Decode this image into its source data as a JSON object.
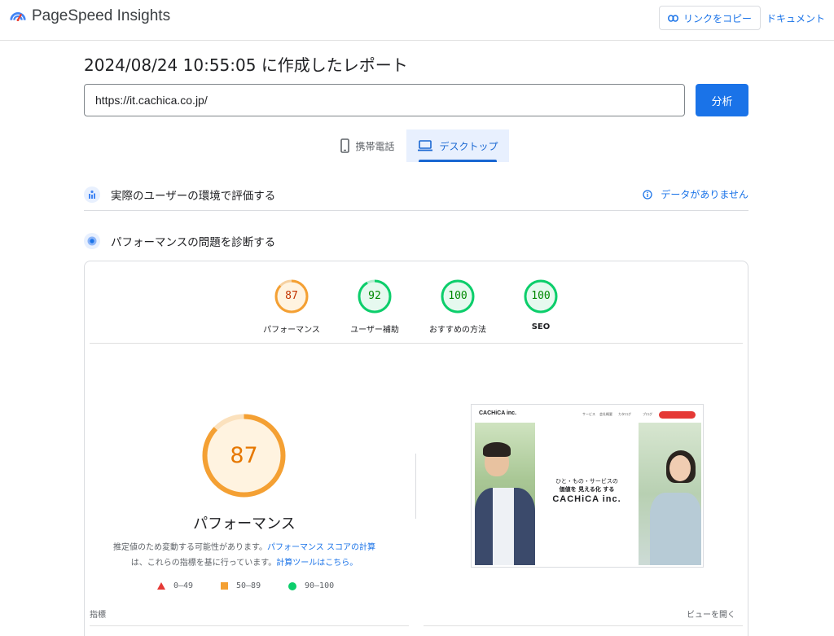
{
  "header": {
    "app_name": "PageSpeed Insights",
    "copy_link_label": "リンクをコピー",
    "docs_label": "ドキュメント"
  },
  "report": {
    "title": "2024/08/24 10:55:05 に作成したレポート",
    "url_value": "https://it.cachica.co.jp/",
    "analyze_label": "分析"
  },
  "tabs": [
    {
      "label": "携帯電話",
      "selected": false
    },
    {
      "label": "デスクトップ",
      "selected": true
    }
  ],
  "sections": {
    "field_title": "実際のユーザーの環境で評価する",
    "no_data": "データがありません",
    "diag_title": "パフォーマンスの問題を診断する"
  },
  "scores": [
    {
      "value": "87",
      "label": "パフォーマンス",
      "color": "#f4a033",
      "text_color": "#c33300"
    },
    {
      "value": "92",
      "label": "ユーザー補助",
      "color": "#0cce6b",
      "text_color": "#008800"
    },
    {
      "value": "100",
      "label": "おすすめの方法",
      "color": "#0cce6b",
      "text_color": "#008800"
    },
    {
      "value": "100",
      "label": "SEO",
      "color": "#0cce6b",
      "text_color": "#008800"
    }
  ],
  "performance": {
    "score": "87",
    "title": "パフォーマンス",
    "note_1": "推定値のため変動する可能性があります。",
    "note_link_1": "パフォーマンス スコアの計算",
    "note_2": "は、これらの指標を基に行っています。",
    "note_link_2": "計算ツールはこちら。"
  },
  "legend": {
    "fail": "0–49",
    "average": "50–89",
    "pass": "90–100"
  },
  "screenshot": {
    "logo": "CACHiCA inc.",
    "nav_items": [
      "サービス",
      "会社概要",
      "カタログ",
      "ブログ"
    ],
    "tagline_1": "ひと・もの・サービスの",
    "tagline_2": "価値を 見える化 する",
    "tagline_3": "CACHiCA inc."
  },
  "metrics": {
    "label": "指標",
    "view_toggle": "ビューを開く"
  },
  "colors": {
    "accent": "#1a73e8",
    "average": "#f4a033",
    "pass": "#0cce6b",
    "fail": "#e53935"
  }
}
